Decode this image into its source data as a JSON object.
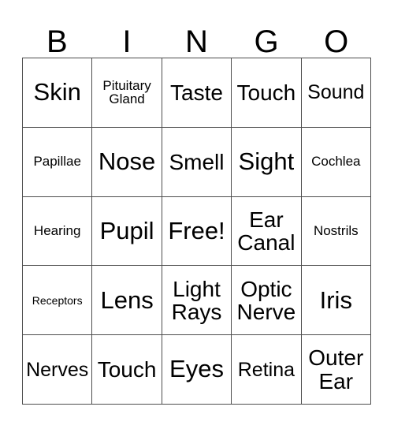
{
  "card": {
    "title": "BINGO",
    "header_letters": [
      "B",
      "I",
      "N",
      "G",
      "O"
    ],
    "free_space_label": "Free!",
    "colors": {
      "background": "#ffffff",
      "text": "#000000",
      "grid_line": "#4d4d4d"
    },
    "grid": {
      "columns": 5,
      "rows": 5,
      "cells": [
        {
          "text": "Skin",
          "size": "xl"
        },
        {
          "text": "Pituitary\nGland",
          "size": "sm"
        },
        {
          "text": "Taste",
          "size": "lg"
        },
        {
          "text": "Touch",
          "size": "lg"
        },
        {
          "text": "Sound",
          "size": "md"
        },
        {
          "text": "Papillae",
          "size": "sm"
        },
        {
          "text": "Nose",
          "size": "xl"
        },
        {
          "text": "Smell",
          "size": "lg"
        },
        {
          "text": "Sight",
          "size": "xl"
        },
        {
          "text": "Cochlea",
          "size": "sm"
        },
        {
          "text": "Hearing",
          "size": "sm"
        },
        {
          "text": "Pupil",
          "size": "xl"
        },
        {
          "text": "Free!",
          "size": "xl"
        },
        {
          "text": "Ear\nCanal",
          "size": "lg"
        },
        {
          "text": "Nostrils",
          "size": "sm"
        },
        {
          "text": "Receptors",
          "size": "xs"
        },
        {
          "text": "Lens",
          "size": "xl"
        },
        {
          "text": "Light\nRays",
          "size": "lg"
        },
        {
          "text": "Optic\nNerve",
          "size": "lg"
        },
        {
          "text": "Iris",
          "size": "xl"
        },
        {
          "text": "Nerves",
          "size": "md"
        },
        {
          "text": "Touch",
          "size": "lg"
        },
        {
          "text": "Eyes",
          "size": "xl"
        },
        {
          "text": "Retina",
          "size": "md"
        },
        {
          "text": "Outer\nEar",
          "size": "lg"
        }
      ]
    }
  }
}
